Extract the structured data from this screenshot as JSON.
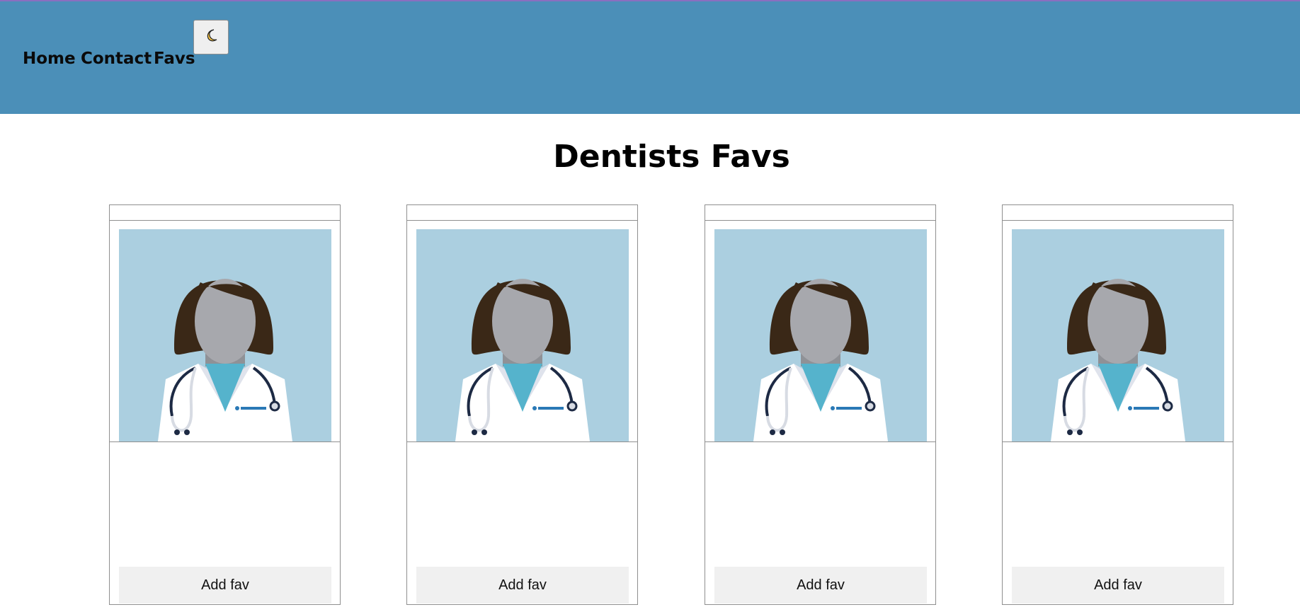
{
  "nav": {
    "links": [
      "Home",
      "Contact",
      "Favs"
    ],
    "theme_toggle_icon": "moon-icon"
  },
  "page": {
    "title": "Dentists Favs"
  },
  "cards": [
    {
      "image": "doctor-avatar-icon",
      "button_label": "Add fav"
    },
    {
      "image": "doctor-avatar-icon",
      "button_label": "Add fav"
    },
    {
      "image": "doctor-avatar-icon",
      "button_label": "Add fav"
    },
    {
      "image": "doctor-avatar-icon",
      "button_label": "Add fav"
    }
  ],
  "colors": {
    "navbar": "#4b8fb8",
    "avatar_background": "#abcfe0",
    "button_background": "#f0f0f0"
  }
}
